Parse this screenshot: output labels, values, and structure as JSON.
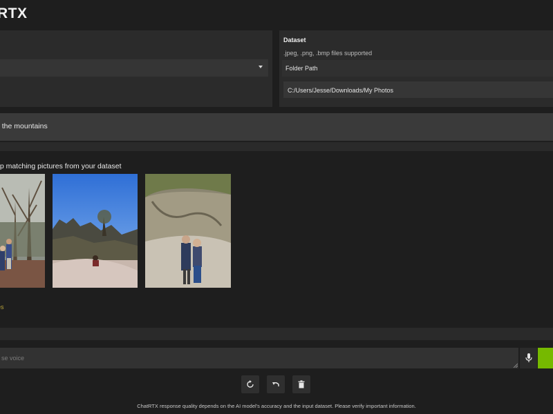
{
  "app": {
    "title": "RTX"
  },
  "dataset": {
    "title": "Dataset",
    "subtitle": ".jpeg, .png, .bmp files supported",
    "folder_label": "Folder Path",
    "folder_path": "C:/Users/Jesse/Downloads/My Photos"
  },
  "conversation": {
    "query": "n the mountains",
    "results_heading": "op matching pictures from your dataset",
    "more_link": "es"
  },
  "chat_input": {
    "placeholder": "se voice"
  },
  "actions": {
    "refresh_icon": "refresh-icon",
    "undo_icon": "undo-icon",
    "delete_icon": "trash-icon"
  },
  "footer": {
    "note": "ChatRTX response quality depends on the AI model's accuracy and the input dataset. Please verify important information."
  },
  "colors": {
    "accent": "#76b900",
    "background": "#1e1e1e",
    "panel": "#2b2b2b"
  }
}
